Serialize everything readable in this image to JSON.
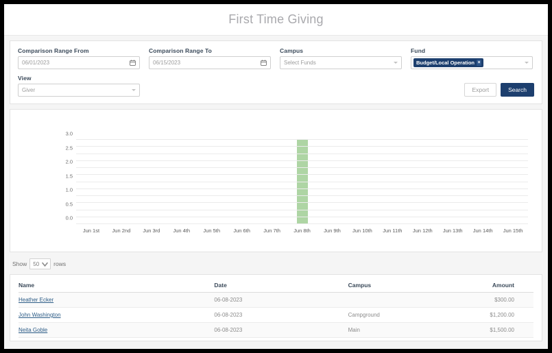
{
  "header": {
    "title": "First Time Giving"
  },
  "filters": {
    "from": {
      "label": "Comparison Range From",
      "value": "06/01/2023",
      "icon": "calendar-icon"
    },
    "to": {
      "label": "Comparison Range To",
      "value": "06/15/2023",
      "icon": "calendar-icon"
    },
    "campus": {
      "label": "Campus",
      "placeholder": "Select Funds",
      "value": "Select Funds"
    },
    "fund": {
      "label": "Fund",
      "chip": "Budget/Local Operation",
      "chip_remove": "×"
    },
    "view": {
      "label": "View",
      "value": "Giver"
    },
    "export_label": "Export",
    "search_label": "Search"
  },
  "colors": {
    "accent": "#1d3f6e",
    "bar": "#aed5a4",
    "title": "#a9a9ad",
    "link": "#2b5b86"
  },
  "chart_data": {
    "type": "bar",
    "title": "",
    "xlabel": "",
    "ylabel": "",
    "categories": [
      "Jun 1st",
      "Jun 2nd",
      "Jun 3rd",
      "Jun 4th",
      "Jun 5th",
      "Jun 6th",
      "Jun 7th",
      "Jun 8th",
      "Jun 9th",
      "Jun 10th",
      "Jun 11th",
      "Jun 12th",
      "Jun 13th",
      "Jun 14th",
      "Jun 15th"
    ],
    "values": [
      0,
      0,
      0,
      0,
      0,
      0,
      0,
      3,
      0,
      0,
      0,
      0,
      0,
      0,
      0
    ],
    "yticks": [
      "0.0",
      "0.5",
      "1.0",
      "1.5",
      "2.0",
      "2.5",
      "3.0"
    ],
    "ytick_values": [
      0.0,
      0.5,
      1.0,
      1.5,
      2.0,
      2.5,
      3.0
    ],
    "ylim": [
      0,
      3
    ],
    "grid": true,
    "minor_grid_step": 0.25,
    "legend": null,
    "bar_color": "#aed5a4"
  },
  "table_controls": {
    "show_label": "Show",
    "rows_value": "50",
    "rows_label": "rows"
  },
  "table": {
    "columns": [
      "Name",
      "Date",
      "Campus",
      "Amount"
    ],
    "rows": [
      {
        "name": "Heather Ecker",
        "date": "06-08-2023",
        "campus": "",
        "amount": "$300.00"
      },
      {
        "name": "John Washington",
        "date": "06-08-2023",
        "campus": "Campground",
        "amount": "$1,200.00"
      },
      {
        "name": "Neita Goble",
        "date": "06-08-2023",
        "campus": "Main",
        "amount": "$1,500.00"
      }
    ]
  }
}
